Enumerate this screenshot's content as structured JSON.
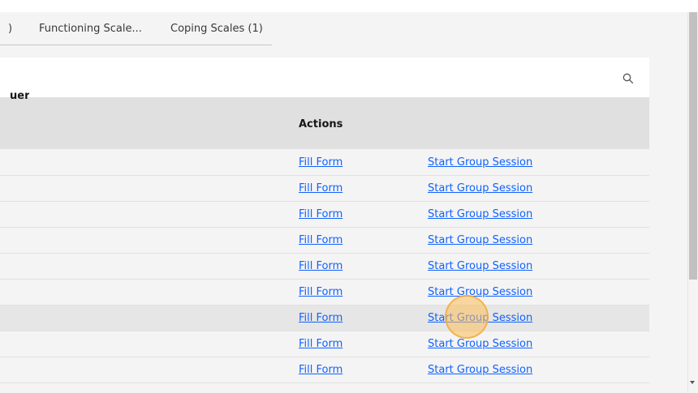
{
  "tabs": [
    {
      "label": ")"
    },
    {
      "label": "Functioning Scale..."
    },
    {
      "label": "Coping Scales (1)"
    }
  ],
  "search": {
    "icon": "search-icon"
  },
  "table": {
    "header_fragment": "uer",
    "actions_header": "Actions",
    "rows": [
      {
        "fill_label": "Fill Form",
        "session_label": "Start Group Session"
      },
      {
        "fill_label": "Fill Form",
        "session_label": "Start Group Session"
      },
      {
        "fill_label": "Fill Form",
        "session_label": "Start Group Session"
      },
      {
        "fill_label": "Fill Form",
        "session_label": "Start Group Session"
      },
      {
        "fill_label": "Fill Form",
        "session_label": "Start Group Session"
      },
      {
        "fill_label": "Fill Form",
        "session_label": "Start Group Session"
      },
      {
        "fill_label": "Fill Form",
        "session_label": "Start Group Session"
      },
      {
        "fill_label": "Fill Form",
        "session_label": "Start Group Session"
      },
      {
        "fill_label": "Fill Form",
        "session_label": "Start Group Session"
      }
    ]
  },
  "colors": {
    "link": "#0f62fe",
    "header_bg": "#e0e0e0",
    "page_bg": "#f4f4f4"
  }
}
